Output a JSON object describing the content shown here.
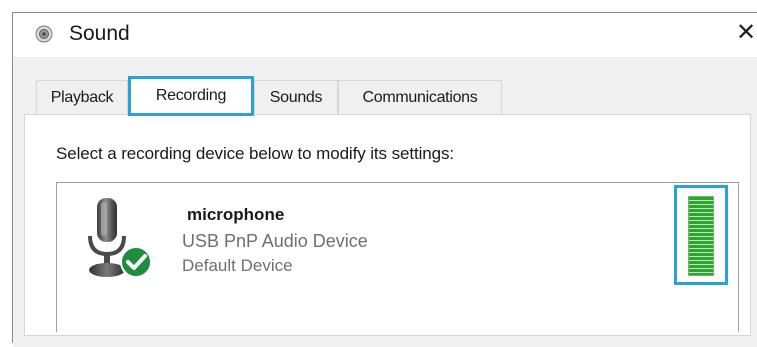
{
  "window": {
    "title": "Sound",
    "close_glyph": "✕",
    "icon": "speaker-icon"
  },
  "tabs": [
    {
      "label": "Playback",
      "active": false
    },
    {
      "label": "Recording",
      "active": true
    },
    {
      "label": "Sounds",
      "active": false
    },
    {
      "label": "Communications",
      "active": false
    }
  ],
  "recording": {
    "instruction": "Select a recording device below to modify its settings:",
    "device": {
      "name": "microphone",
      "description": "USB PnP Audio Device",
      "status": "Default Device",
      "icon": "microphone-icon",
      "status_icon": "checkmark-icon",
      "level_meter": "level-meter-icon"
    }
  },
  "colors": {
    "highlight": "#2aa1d9",
    "check_green": "#1e8e3e",
    "meter_green": "#2fa52f"
  }
}
